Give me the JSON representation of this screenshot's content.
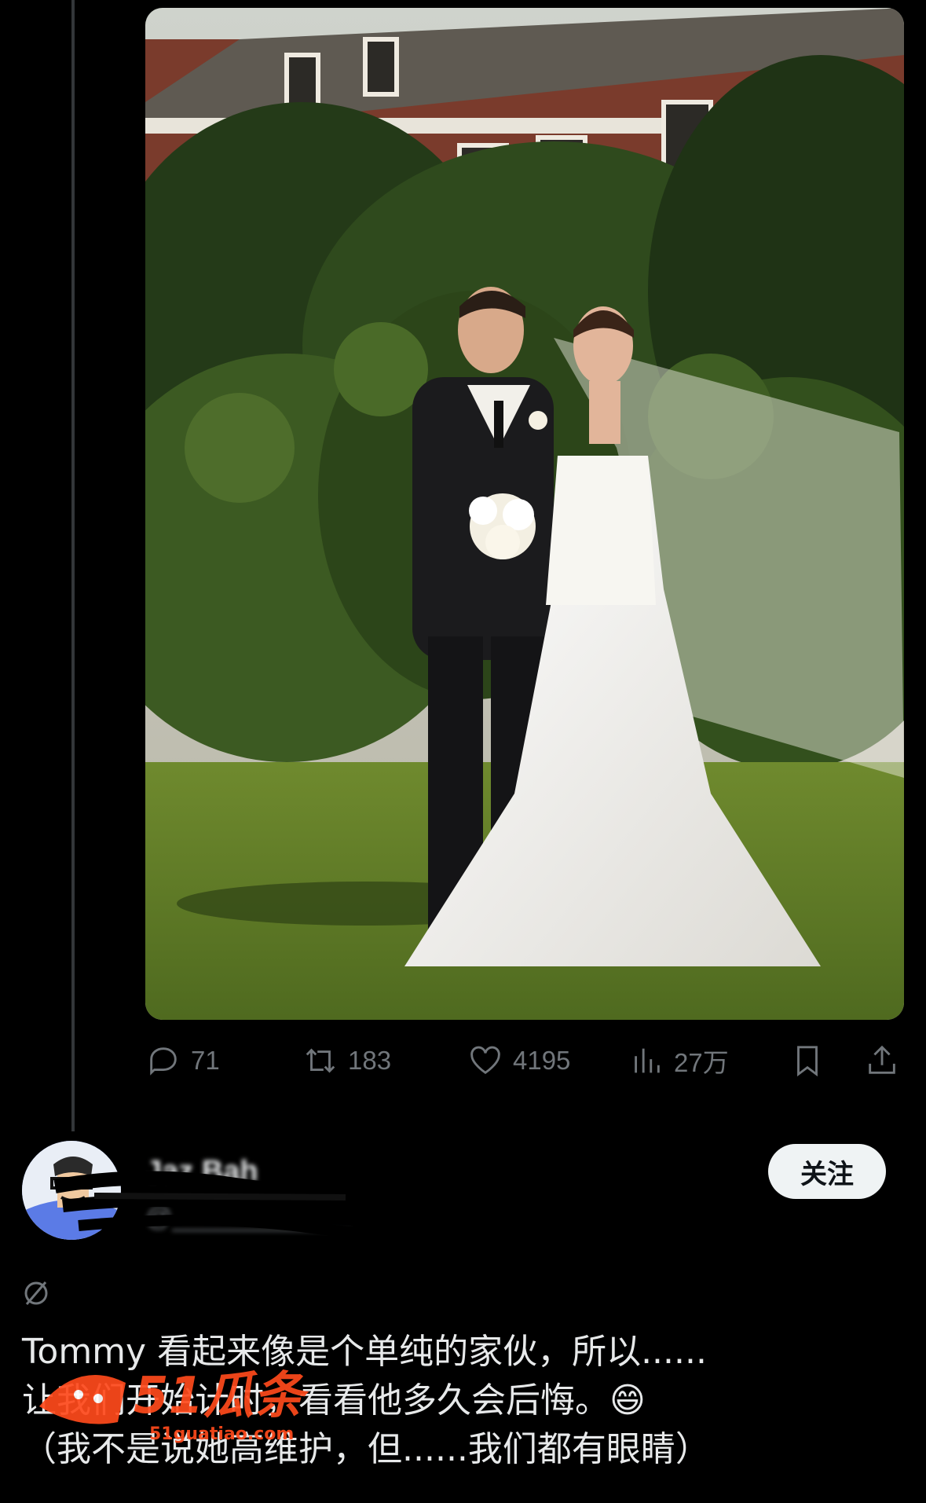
{
  "post": {
    "actions": {
      "replies": "71",
      "retweets": "183",
      "likes": "4195",
      "views": "27万"
    },
    "icons": {
      "reply": "reply-icon",
      "retweet": "retweet-icon",
      "like": "heart-icon",
      "views": "views-chart-icon",
      "bookmark": "bookmark-icon",
      "share": "share-icon"
    }
  },
  "reply": {
    "name": "Jaz Bah",
    "handle": "@____________",
    "follow_label": "关注",
    "lines": [
      "Tommy 看起来像是个单纯的家伙，所以......",
      "让我们开始计时，看看他多久会后悔。😄",
      "（我不是说她高维护，但......我们都有眼睛）"
    ]
  },
  "watermark": {
    "brand": "51瓜条",
    "url": "51guatiao.com"
  },
  "colors": {
    "background": "#000000",
    "text": "#e7e9ea",
    "muted": "#71767b",
    "follow_bg": "#eff3f4",
    "watermark": "#ff4a1c"
  }
}
